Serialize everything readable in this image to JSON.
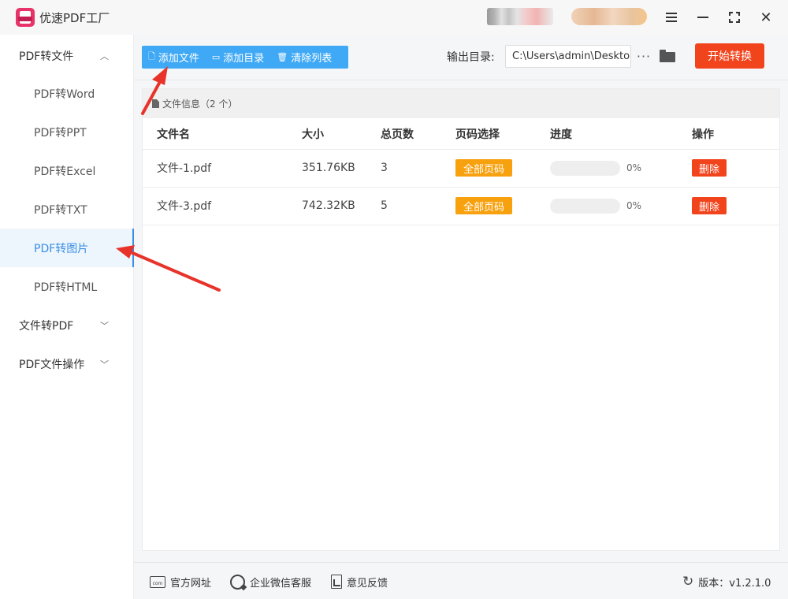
{
  "app": {
    "title": "优速PDF工厂"
  },
  "sidebar": {
    "groups": [
      {
        "label": "PDF转文件",
        "chevron": "chevron-up-icon"
      },
      {
        "label": "文件转PDF",
        "chevron": "chevron-down-icon"
      },
      {
        "label": "PDF文件操作",
        "chevron": "chevron-down-icon"
      }
    ],
    "items": [
      {
        "label": "PDF转Word"
      },
      {
        "label": "PDF转PPT"
      },
      {
        "label": "PDF转Excel"
      },
      {
        "label": "PDF转TXT"
      },
      {
        "label": "PDF转图片",
        "active": true
      },
      {
        "label": "PDF转HTML"
      }
    ]
  },
  "toolbar": {
    "add_file": "添加文件",
    "add_dir": "添加目录",
    "clear_list": "清除列表",
    "output_label": "输出目录:",
    "output_path": "C:\\Users\\admin\\Deskto",
    "more": "···",
    "start": "开始转换"
  },
  "file_panel": {
    "header": "文件信息（2 个）",
    "columns": [
      "文件名",
      "大小",
      "总页数",
      "页码选择",
      "进度",
      "操作"
    ],
    "rows": [
      {
        "name": "文件-1.pdf",
        "size": "351.76KB",
        "pages": "3",
        "page_select": "全部页码",
        "progress": 0,
        "progress_text": "0%",
        "action": "删除"
      },
      {
        "name": "文件-3.pdf",
        "size": "742.32KB",
        "pages": "5",
        "page_select": "全部页码",
        "progress": 0,
        "progress_text": "0%",
        "action": "删除"
      }
    ]
  },
  "footer": {
    "website": "官方网址",
    "wechat": "企业微信客服",
    "feedback": "意见反馈",
    "version": "版本：v1.2.1.0"
  },
  "colors": {
    "accent_blue": "#3fa9f5",
    "start_orange": "#f1441d",
    "badge_orange": "#f7a10f",
    "active_blue": "#3a8ee6",
    "logo_pink": "#e8336a",
    "arrow_red": "#e8332a"
  }
}
